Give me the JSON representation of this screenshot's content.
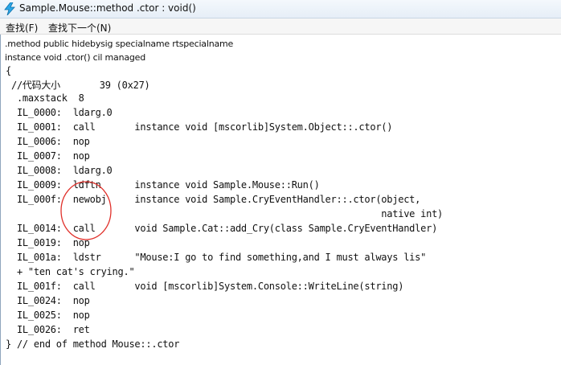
{
  "window": {
    "title": "Sample.Mouse::method .ctor : void()",
    "app_icon": "lightning-bolt-icon"
  },
  "menu": {
    "items": [
      {
        "label": "查找(F)"
      },
      {
        "label": "查找下一个(N)"
      }
    ]
  },
  "header": {
    "line1": ".method public hidebysig specialname rtspecialname",
    "line2": "      instance void  .ctor() cil managed"
  },
  "code": {
    "lines": [
      "{",
      " //代码大小       39 (0x27)",
      "  .maxstack  8",
      "  IL_0000:  ldarg.0",
      "  IL_0001:  call       instance void [mscorlib]System.Object::.ctor()",
      "  IL_0006:  nop",
      "  IL_0007:  nop",
      "  IL_0008:  ldarg.0",
      "  IL_0009:  ldftn      instance void Sample.Mouse::Run()",
      "  IL_000f:  newobj     instance void Sample.CryEventHandler::.ctor(object,",
      "                                                                   native int)",
      "  IL_0014:  call       void Sample.Cat::add_Cry(class Sample.CryEventHandler)",
      "  IL_0019:  nop",
      "  IL_001a:  ldstr      \"Mouse:I go to find something,and I must always lis\"",
      "  + \"ten cat's crying.\"",
      "  IL_001f:  call       void [mscorlib]System.Console::WriteLine(string)",
      "  IL_0024:  nop",
      "  IL_0025:  nop",
      "  IL_0026:  ret",
      "} // end of method Mouse::.ctor"
    ]
  },
  "annotation": {
    "color": "#e0302a"
  }
}
